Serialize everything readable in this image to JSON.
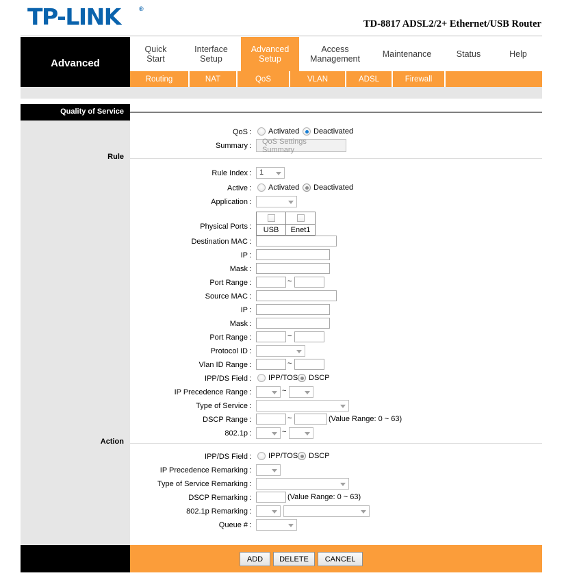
{
  "header": {
    "logo_text": "TP-LINK",
    "logo_registered": "®",
    "model": "TD-8817 ADSL2/2+ Ethernet/USB Router"
  },
  "nav": {
    "brand_cell": "Advanced",
    "items": [
      {
        "label": "Quick Start",
        "line1": "Quick",
        "line2": "Start",
        "active": false
      },
      {
        "label": "Interface Setup",
        "line1": "Interface",
        "line2": "Setup",
        "active": false
      },
      {
        "label": "Advanced Setup",
        "line1": "Advanced",
        "line2": "Setup",
        "active": true
      },
      {
        "label": "Access Management",
        "line1": "Access",
        "line2": "Management",
        "active": false
      },
      {
        "label": "Maintenance",
        "line1": "Maintenance",
        "line2": "",
        "active": false
      },
      {
        "label": "Status",
        "line1": "Status",
        "line2": "",
        "active": false
      },
      {
        "label": "Help",
        "line1": "Help",
        "line2": "",
        "active": false
      }
    ],
    "subitems": [
      {
        "label": "Routing"
      },
      {
        "label": "NAT"
      },
      {
        "label": "QoS"
      },
      {
        "label": "VLAN"
      },
      {
        "label": "ADSL"
      },
      {
        "label": "Firewall"
      }
    ]
  },
  "sections": {
    "qos_title": "Quality of Service",
    "rule_title": "Rule",
    "action_title": "Action"
  },
  "qos": {
    "qos_label": "QoS",
    "qos_activated": "Activated",
    "qos_deactivated": "Deactivated",
    "qos_selected": "Deactivated",
    "summary_label": "Summary",
    "summary_button": "QoS Settings Summary"
  },
  "rule": {
    "rule_index_label": "Rule Index",
    "rule_index_value": "1",
    "active_label": "Active",
    "active_activated": "Activated",
    "active_deactivated": "Deactivated",
    "active_selected": "Deactivated",
    "application_label": "Application",
    "application_value": "",
    "physical_ports_label": "Physical Ports",
    "ports": [
      {
        "name": "USB",
        "checked": false
      },
      {
        "name": "Enet1",
        "checked": false
      }
    ],
    "dest_mac_label": "Destination MAC",
    "dest_mac_value": "",
    "dest_ip_label": "IP",
    "dest_ip_value": "",
    "dest_mask_label": "Mask",
    "dest_mask_value": "",
    "dest_port_range_label": "Port Range",
    "dest_port_from": "",
    "dest_port_to": "",
    "src_mac_label": "Source MAC",
    "src_mac_value": "",
    "src_ip_label": "IP",
    "src_ip_value": "",
    "src_mask_label": "Mask",
    "src_mask_value": "",
    "src_port_range_label": "Port Range",
    "src_port_from": "",
    "src_port_to": "",
    "protocol_id_label": "Protocol ID",
    "protocol_id_value": "",
    "vlan_id_range_label": "Vlan ID Range",
    "vlan_from": "",
    "vlan_to": "",
    "ippds_label": "IPP/DS Field",
    "ipptos_option": "IPP/TOS",
    "dscp_option": "DSCP",
    "ippds_selected": "DSCP",
    "ip_prec_range_label": "IP Precedence Range",
    "ip_prec_from": "",
    "ip_prec_to": "",
    "tos_label": "Type of Service",
    "tos_value": "",
    "dscp_range_label": "DSCP Range",
    "dscp_from": "",
    "dscp_to": "",
    "dscp_hint": "(Value Range: 0 ~ 63)",
    "dot1p_label": "802.1p",
    "dot1p_from": "",
    "dot1p_to": "",
    "tilde": "~"
  },
  "action": {
    "ippds_label": "IPP/DS Field",
    "ipptos_option": "IPP/TOS",
    "dscp_option": "DSCP",
    "ippds_selected": "DSCP",
    "ip_prec_remark_label": "IP Precedence Remarking",
    "ip_prec_remark_value": "",
    "tos_remark_label": "Type of Service Remarking",
    "tos_remark_value": "",
    "dscp_remark_label": "DSCP Remarking",
    "dscp_remark_value": "",
    "dscp_remark_hint": "(Value Range: 0 ~ 63)",
    "dot1p_remark_label": "802.1p Remarking",
    "dot1p_remark_small": "",
    "dot1p_remark_wide": "",
    "queue_label": "Queue #",
    "queue_value": ""
  },
  "footer": {
    "add": "ADD",
    "delete": "DELETE",
    "cancel": "CANCEL"
  },
  "colors": {
    "brand_blue": "#0a63ad",
    "accent_orange": "#fb9d3a",
    "sidebar_grey": "#e6e6e6",
    "header_black": "#000000",
    "radio_blue": "#1a7fd4"
  }
}
